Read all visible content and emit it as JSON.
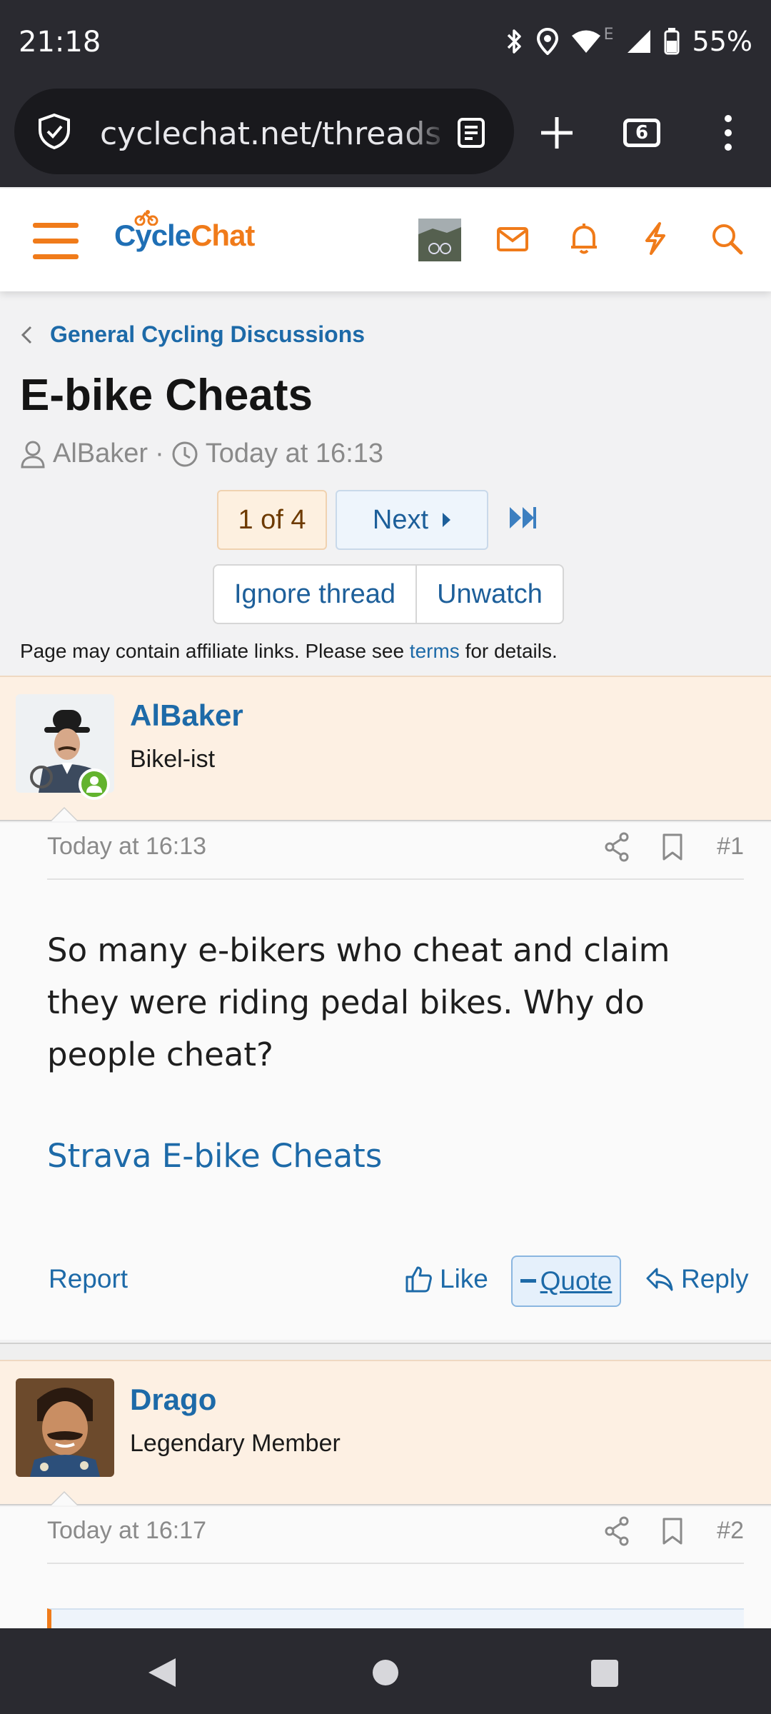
{
  "status": {
    "time": "21:18",
    "network_label": "E",
    "battery": "55%"
  },
  "browser": {
    "url": "cyclechat.net/threads",
    "tab_count": "6"
  },
  "site": {
    "logo_part1": "Cycle",
    "logo_part2": "Chat",
    "accent_color": "#f07b1a",
    "link_color": "#1d6aa8"
  },
  "breadcrumb": "General Cycling Discussions",
  "thread": {
    "title": "E-bike Cheats",
    "author": "AlBaker",
    "separator": "·",
    "date": "Today at 16:13"
  },
  "pager": {
    "current": "1 of 4",
    "next": "Next"
  },
  "actions": {
    "ignore": "Ignore thread",
    "unwatch": "Unwatch"
  },
  "notice": {
    "prefix": "Page may contain affiliate links. Please see",
    "link": "terms",
    "suffix": "for details."
  },
  "posts": [
    {
      "username": "AlBaker",
      "user_title": "Bikel-ist",
      "online": true,
      "date": "Today at 16:13",
      "number": "#1",
      "body": "So many e-bikers who cheat and claim they were riding pedal bikes. Why do people cheat?",
      "link_text": "Strava E-bike Cheats",
      "report": "Report",
      "like": "Like",
      "quote": "Quote",
      "reply": "Reply"
    },
    {
      "username": "Drago",
      "user_title": "Legendary Member",
      "online": false,
      "date": "Today at 16:17",
      "number": "#2"
    }
  ]
}
